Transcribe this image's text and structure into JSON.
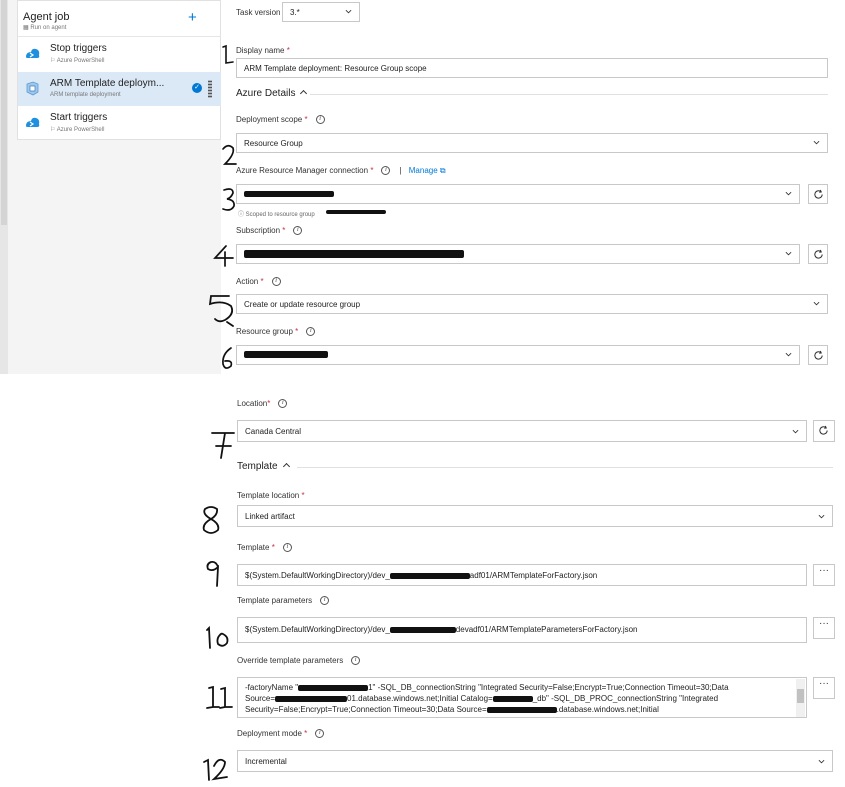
{
  "agent_job": {
    "title": "Agent job",
    "subtitle": "Run on agent",
    "add_label": "+"
  },
  "tasks": [
    {
      "name": "Stop triggers",
      "sub": "Azure PowerShell",
      "icon": "azure-powershell-icon"
    },
    {
      "name": "ARM Template deploym...",
      "sub": "ARM template deployment",
      "icon": "arm-template-icon",
      "selected": true
    },
    {
      "name": "Start triggers",
      "sub": "Azure PowerShell",
      "icon": "azure-powershell-icon"
    }
  ],
  "form": {
    "task_version_label": "Task version",
    "task_version_value": "3.*",
    "display_name_label": "Display name",
    "display_name_value": "ARM Template deployment: Resource Group scope",
    "azure_details_label": "Azure Details",
    "deployment_scope_label": "Deployment scope",
    "deployment_scope_value": "Resource Group",
    "arm_connection_label": "Azure Resource Manager connection",
    "manage_label": "Manage",
    "arm_connection_hint": "Scoped to resource group",
    "subscription_label": "Subscription",
    "action_label": "Action",
    "action_value": "Create or update resource group",
    "resource_group_label": "Resource group",
    "location_label": "Location",
    "location_value": "Canada Central",
    "template_section_label": "Template",
    "template_location_label": "Template location",
    "template_location_value": "Linked artifact",
    "template_label": "Template",
    "template_value_a": "$(System.DefaultWorkingDirectory)/dev_",
    "template_value_b": "adf01/ARMTemplateForFactory.json",
    "template_params_label": "Template parameters",
    "template_params_value_a": "$(System.DefaultWorkingDirectory)/dev_",
    "template_params_value_b": "devadf01/ARMTemplateParametersForFactory.json",
    "override_label": "Override template parameters",
    "override_line1_a": "-factoryName \"",
    "override_line1_b": "1\" -SQL_DB_connectionString \"Integrated Security=False;Encrypt=True;Connection Timeout=30;Data",
    "override_line2_a": "Source=",
    "override_line2_b": "01.database.windows.net;Initial Catalog=",
    "override_line2_c": "_db\" -SQL_DB_PROC_connectionString \"Integrated",
    "override_line3_a": "Security=False;Encrypt=True;Connection Timeout=30;Data Source=",
    "override_line3_b": ".database.windows.net;Initial",
    "deployment_mode_label": "Deployment mode",
    "deployment_mode_value": "Incremental",
    "required_mark": "*",
    "more_label": "···",
    "manage_separator": "|"
  },
  "annotations": [
    "1",
    "2",
    "3",
    "4",
    "5",
    "6",
    "7",
    "8",
    "9",
    "10",
    "11",
    "12"
  ],
  "colors": {
    "accent": "#0078d4",
    "required": "#c4314b",
    "selected_row": "#dbe9f7"
  }
}
